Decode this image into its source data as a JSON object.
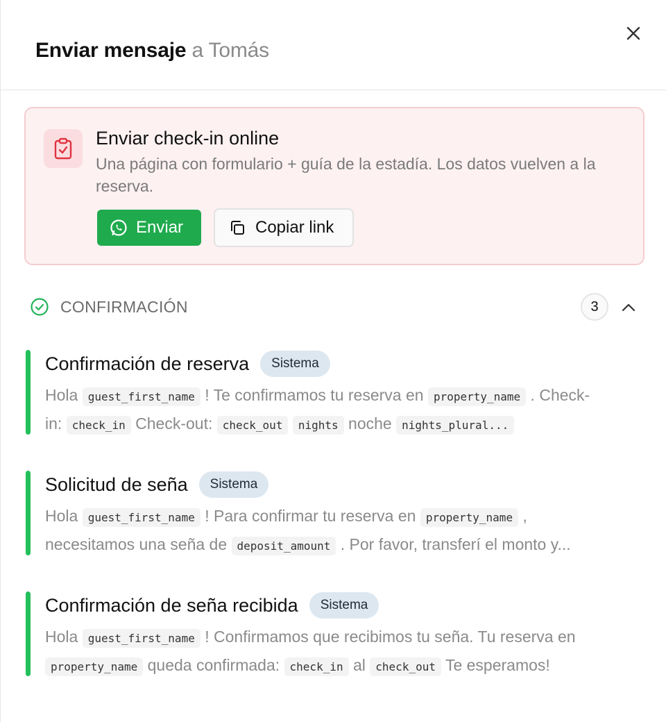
{
  "header": {
    "title_strong": "Enviar mensaje",
    "title_muted": "a Tomás",
    "close_icon": "close-icon"
  },
  "checkin": {
    "icon": "clipboard-check-icon",
    "title": "Enviar check-in online",
    "description": "Una página con formulario + guía de la estadía. Los datos vuelven a la reserva.",
    "send_label": "Enviar",
    "send_icon": "whatsapp-icon",
    "copy_label": "Copiar link",
    "copy_icon": "copy-icon"
  },
  "section": {
    "title": "CONFIRMACIÓN",
    "count": "3",
    "icon": "check-circle-icon",
    "chevron": "chevron-up-icon"
  },
  "templates": [
    {
      "name": "Confirmación de reserva",
      "badge": "Sistema",
      "line1": [
        {
          "t": "text",
          "v": "Hola "
        },
        {
          "t": "var",
          "v": "guest_first_name"
        },
        {
          "t": "text",
          "v": " ! Te confirmamos tu reserva en "
        },
        {
          "t": "var",
          "v": "property_name"
        },
        {
          "t": "text",
          "v": " . Check-"
        }
      ],
      "line2": [
        {
          "t": "text",
          "v": "in: "
        },
        {
          "t": "var",
          "v": "check_in"
        },
        {
          "t": "text",
          "v": " Check-out: "
        },
        {
          "t": "var",
          "v": "check_out"
        },
        {
          "t": "text",
          "v": "  "
        },
        {
          "t": "var",
          "v": "nights"
        },
        {
          "t": "text",
          "v": " noche "
        },
        {
          "t": "var",
          "v": "nights_plural..."
        }
      ]
    },
    {
      "name": "Solicitud de seña",
      "badge": "Sistema",
      "line1": [
        {
          "t": "text",
          "v": "Hola "
        },
        {
          "t": "var",
          "v": "guest_first_name"
        },
        {
          "t": "text",
          "v": " ! Para confirmar tu reserva en "
        },
        {
          "t": "var",
          "v": "property_name"
        },
        {
          "t": "text",
          "v": " ,"
        }
      ],
      "line2": [
        {
          "t": "text",
          "v": "necesitamos una seña de "
        },
        {
          "t": "var",
          "v": "deposit_amount"
        },
        {
          "t": "text",
          "v": " . Por favor, transferí el monto y..."
        }
      ]
    },
    {
      "name": "Confirmación de seña recibida",
      "badge": "Sistema",
      "line1": [
        {
          "t": "text",
          "v": "Hola "
        },
        {
          "t": "var",
          "v": "guest_first_name"
        },
        {
          "t": "text",
          "v": " ! Confirmamos que recibimos tu seña. Tu reserva en"
        }
      ],
      "line2": [
        {
          "t": "var",
          "v": "property_name"
        },
        {
          "t": "text",
          "v": " queda confirmada: "
        },
        {
          "t": "var",
          "v": "check_in"
        },
        {
          "t": "text",
          "v": " al "
        },
        {
          "t": "var",
          "v": "check_out"
        },
        {
          "t": "text",
          "v": " Te esperamos!"
        }
      ]
    }
  ],
  "colors": {
    "accent_green": "#1faa4d",
    "bar_green": "#23c05b",
    "card_bg": "#fdf1f2",
    "card_border": "#f5cdd1",
    "icon_red": "#e0323f",
    "badge_bg": "#dde7f0"
  }
}
